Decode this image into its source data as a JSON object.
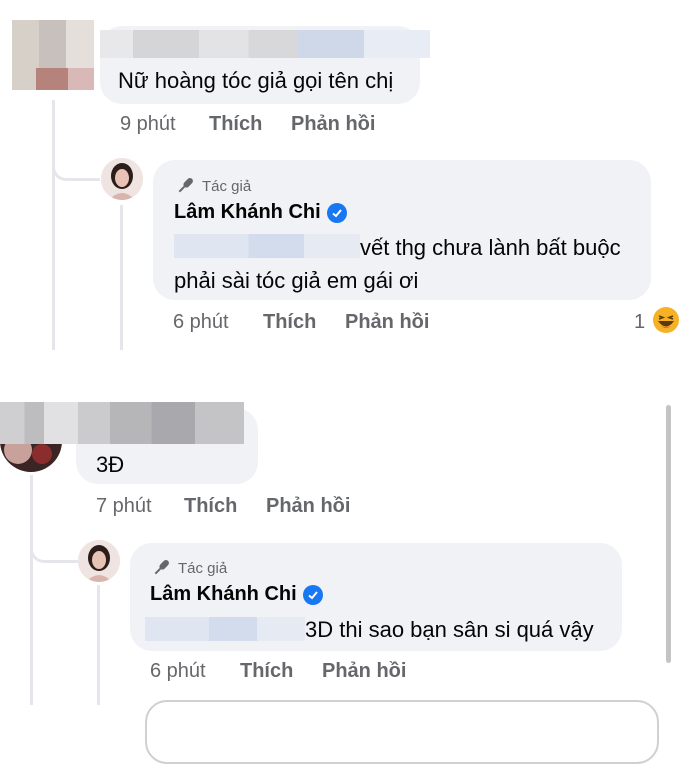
{
  "comments": [
    {
      "text": "Nữ hoàng tóc giả gọi tên chị",
      "time": "9 phút",
      "like": "Thích",
      "reply": "Phản hồi",
      "reply_comment": {
        "author_badge": "Tác giả",
        "author_name": "Lâm Khánh Chi",
        "text_line1": "vết thg chưa lành bất buộc",
        "text_line2": "phải sài tóc giả em gái ơi",
        "time": "6 phút",
        "like": "Thích",
        "reply": "Phản hồi",
        "reaction_count": "1",
        "reaction_icon": "laugh-emoji"
      }
    },
    {
      "text": "3Đ",
      "time": "7 phút",
      "like": "Thích",
      "reply": "Phản hồi",
      "reply_comment": {
        "author_badge": "Tác giả",
        "author_name": "Lâm Khánh Chi",
        "text": "3D thi sao bạn sân si quá vậy",
        "time": "6 phút",
        "like": "Thích",
        "reply": "Phản hồi"
      }
    }
  ],
  "colors": {
    "bubble": "#f0f2f5",
    "meta_text": "#65676b",
    "verified": "#1877f2",
    "thread_line": "#e4e6eb"
  }
}
